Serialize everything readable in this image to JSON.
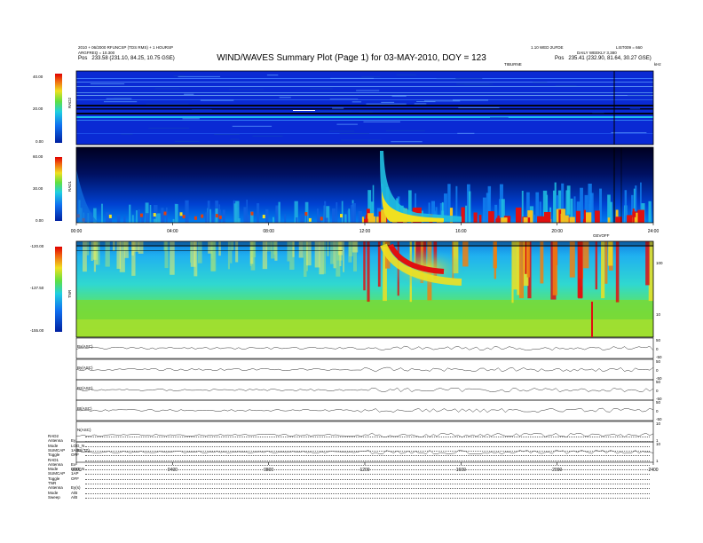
{
  "header": {
    "title": "WIND/WAVES Summary Plot (Page 1) for 03-MAY-2010, DOY = 123",
    "left_line1": "2010 + 06/2000 RFUNCSP (TDS RMS) + 1 HOURSP",
    "left_line2": "ARGFREQ = 10.300",
    "left_pos_label": "Pos",
    "left_pos_value": "233.58 (231.10, 84.25, 10.75 GSE)",
    "right_line1": "1.10 WED 2UFDE",
    "right_line1b": "LIST009 = 660",
    "right_line2": "DAILY WEEKLY 3,380",
    "right_pos_label": "Pos",
    "right_pos_value": "235.41 (232.90, 81.64, 30.27 GSE)",
    "top_tag": "TIBURNE",
    "top_unit": "kHz"
  },
  "colors": {
    "background_low": "#0a2bd6",
    "cold": "#000030",
    "mid": "#20c0e0",
    "green": "#60d040",
    "yellow": "#f0e020",
    "hot": "#e01010"
  },
  "chart_data": [
    {
      "type": "heatmap",
      "name": "RAD2",
      "ylabel": "RAD2",
      "yticks": [
        "40.00",
        "20.00",
        "0.00"
      ],
      "ylim": [
        0,
        40
      ],
      "xlim": [
        0,
        24
      ],
      "description": "spectrogram, mostly background blue with horizontal interference lines"
    },
    {
      "type": "heatmap",
      "name": "RAD1",
      "ylabel": "RAD1",
      "yticks": [
        "60.00",
        "30.00",
        "0.00"
      ],
      "ylim": [
        0,
        60
      ],
      "xticks": [
        "00:00",
        "04:00",
        "08:00",
        "12:00",
        "16:00",
        "20:00",
        "24:00"
      ],
      "x": [
        0,
        4,
        8,
        12,
        16,
        20,
        24
      ],
      "burst_start_hour": 13.1,
      "activity_from_hour": 11.8
    },
    {
      "type": "heatmap",
      "name": "TNR",
      "ylabel": "TNR",
      "yticks": [
        "-120.00",
        "-137.50",
        "-155.00"
      ],
      "ylim": [
        -155,
        -120
      ],
      "right_ticks": [
        "100",
        "10"
      ],
      "tag": "GEVOFF"
    },
    {
      "type": "line",
      "panels": [
        {
          "label": "Bx(ASC)",
          "right_ticks": [
            "50",
            "0",
            "-50"
          ]
        },
        {
          "label": "By(ASC)",
          "right_ticks": [
            "50",
            "0",
            "-50"
          ]
        },
        {
          "label": "Bz(ASC)",
          "right_ticks": [
            "50",
            "0",
            "-50"
          ]
        },
        {
          "label": "Bt(ASC)",
          "right_ticks": [
            "50",
            "0",
            "-50"
          ]
        },
        {
          "label": "N(ASC)",
          "right_ticks": [
            "10",
            "1"
          ]
        },
        {
          "label": "|B|(TT)",
          "right_ticks": [
            "10",
            "1"
          ]
        }
      ],
      "xticks": [
        "0000",
        "0400",
        "0800",
        "1200",
        "1600",
        "2000",
        "2400"
      ],
      "x": [
        0,
        4,
        8,
        12,
        16,
        20,
        24
      ]
    }
  ],
  "footer": {
    "rows": [
      {
        "k": "RAD2",
        "v": ""
      },
      {
        "k": "Antenna",
        "v": "Ey"
      },
      {
        "k": "Mode",
        "v": "LOG_N"
      },
      {
        "k": "SUMCAP",
        "v": "1AP"
      },
      {
        "k": "Toggle",
        "v": "OFF"
      },
      {
        "k": "RAD1",
        "v": ""
      },
      {
        "k": "Antenna",
        "v": "Ex"
      },
      {
        "k": "Mode",
        "v": "LOG_N"
      },
      {
        "k": "SUMCAP",
        "v": "1AP"
      },
      {
        "k": "Toggle",
        "v": "OFF"
      },
      {
        "k": "TNR",
        "v": ""
      },
      {
        "k": "Antenna",
        "v": "Ey(s)"
      },
      {
        "k": "Mode",
        "v": "A/B"
      },
      {
        "k": "Sweep",
        "v": "A/B"
      }
    ]
  }
}
